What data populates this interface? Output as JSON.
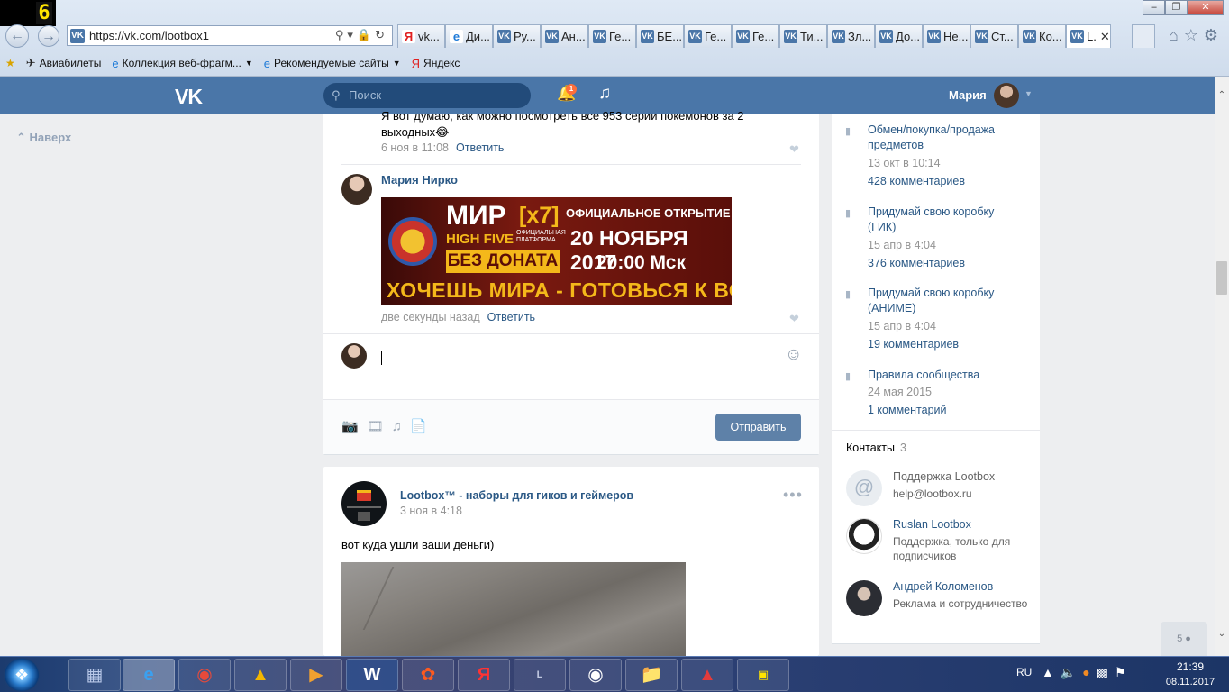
{
  "window_badge": "6",
  "browser": {
    "url": "https://vk.com/lootbox1",
    "tabs": [
      {
        "icon": "Я",
        "icon_type": "y",
        "label": "vk..."
      },
      {
        "icon": "e",
        "icon_type": "ie",
        "label": "Ди..."
      },
      {
        "icon": "VK",
        "icon_type": "vk",
        "label": "Ру..."
      },
      {
        "icon": "VK",
        "icon_type": "vk",
        "label": "Ан..."
      },
      {
        "icon": "VK",
        "icon_type": "vk",
        "label": "Ге..."
      },
      {
        "icon": "VK",
        "icon_type": "vk",
        "label": "БЕ..."
      },
      {
        "icon": "VK",
        "icon_type": "vk",
        "label": "Ге..."
      },
      {
        "icon": "VK",
        "icon_type": "vk",
        "label": "Ге..."
      },
      {
        "icon": "VK",
        "icon_type": "vk",
        "label": "Ти..."
      },
      {
        "icon": "VK",
        "icon_type": "vk",
        "label": "Зл..."
      },
      {
        "icon": "VK",
        "icon_type": "vk",
        "label": "До..."
      },
      {
        "icon": "VK",
        "icon_type": "vk",
        "label": "Не..."
      },
      {
        "icon": "VK",
        "icon_type": "vk",
        "label": "Ст..."
      },
      {
        "icon": "VK",
        "icon_type": "vk",
        "label": "Ко..."
      }
    ],
    "active_tab": {
      "icon": "VK",
      "label": "L."
    },
    "favorites": [
      {
        "icon": "✈",
        "label": "Авиабилеты",
        "dropdown": false
      },
      {
        "icon": "e",
        "label": "Коллекция веб-фрагм...",
        "dropdown": true
      },
      {
        "icon": "e",
        "label": "Рекомендуемые сайты",
        "dropdown": true
      },
      {
        "icon": "Я",
        "label": "Яндекс",
        "dropdown": false
      }
    ]
  },
  "vk_header": {
    "logo": "VK",
    "search_placeholder": "Поиск",
    "notifications_count": "1",
    "user_name": "Мария"
  },
  "left": {
    "back_to_top": "Наверх"
  },
  "comments": [
    {
      "text": "Я вот думаю, как можно посмотреть все 953 серии покемонов за 2 выходных😂",
      "date": "6 ноя в 11:08",
      "reply": "Ответить"
    },
    {
      "author": "Мария Нирко",
      "banner": {
        "title": "МИР",
        "title_x": "[x7]",
        "subtitle": "HIGH FIVE",
        "subtitle_small": "ОФИЦИАЛЬНАЯ ПЛАТФОРМА",
        "no_donate": "БЕЗ ДОНАТА",
        "opening": "ОФИЦИАЛЬНОЕ ОТКРЫТИЕ",
        "date": "20 НОЯБРЯ 2017",
        "time": "20:00 Мск",
        "slogan": "ХОЧЕШЬ МИРА - ГОТОВЬСЯ К ВОЙНЕ"
      },
      "date": "две секунды назад",
      "reply": "Ответить"
    }
  ],
  "composer": {
    "send_label": "Отправить"
  },
  "post": {
    "author": "Lootbox™ - наборы для гиков и геймеров",
    "date": "3 ноя в 4:18",
    "text": "вот куда ушли ваши деньги)"
  },
  "sidebar": {
    "topics": [
      {
        "title": "Обмен/покупка/продажа предметов",
        "date": "13 окт в 10:14",
        "count": "428 комментариев"
      },
      {
        "title": "Придумай свою коробку (ГИК)",
        "date": "15 апр в 4:04",
        "count": "376 комментариев"
      },
      {
        "title": "Придумай свою коробку (АНИМЕ)",
        "date": "15 апр в 4:04",
        "count": "19 комментариев"
      },
      {
        "title": "Правила сообщества",
        "date": "24 мая 2015",
        "count": "1 комментарий"
      }
    ],
    "contacts_title": "Контакты",
    "contacts_count": "3",
    "contacts": [
      {
        "name": "Поддержка Lootbox",
        "desc": "help@lootbox.ru"
      },
      {
        "name": "Ruslan Lootbox",
        "desc": "Поддержка, только для подписчиков"
      },
      {
        "name": "Андрей Коломенов",
        "desc": "Реклама и сотрудничество"
      }
    ],
    "online_count": "5"
  },
  "taskbar": {
    "lang": "RU",
    "time": "21:39",
    "date": "08.11.2017"
  }
}
